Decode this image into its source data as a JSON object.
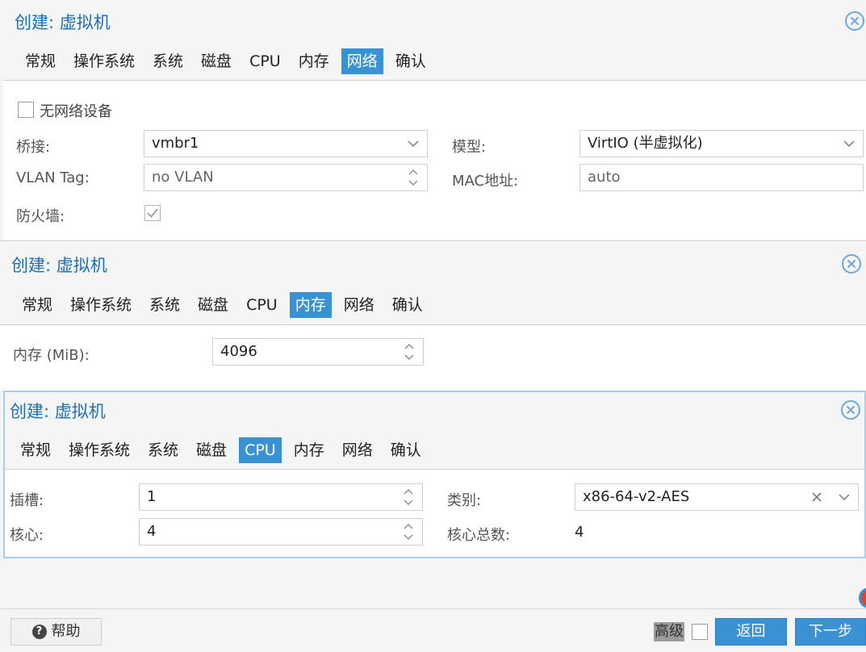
{
  "network": {
    "title": "创建: 虚拟机",
    "tabs": [
      "常规",
      "操作系统",
      "系统",
      "磁盘",
      "CPU",
      "内存",
      "网络",
      "确认"
    ],
    "active_tab": 6,
    "no_network_label": "无网络设备",
    "bridge_label": "桥接:",
    "bridge_value": "vmbr1",
    "model_label": "模型:",
    "model_value": "VirtIO (半虚拟化)",
    "vlan_label": "VLAN Tag:",
    "vlan_value": "no VLAN",
    "mac_label": "MAC地址:",
    "mac_value": "auto",
    "firewall_label": "防火墙:"
  },
  "memory": {
    "title": "创建: 虚拟机",
    "tabs": [
      "常规",
      "操作系统",
      "系统",
      "磁盘",
      "CPU",
      "内存",
      "网络",
      "确认"
    ],
    "active_tab": 5,
    "memory_label": "内存 (MiB):",
    "memory_value": "4096"
  },
  "cpu": {
    "title": "创建: 虚拟机",
    "tabs": [
      "常规",
      "操作系统",
      "系统",
      "磁盘",
      "CPU",
      "内存",
      "网络",
      "确认"
    ],
    "active_tab": 4,
    "sockets_label": "插槽:",
    "sockets_value": "1",
    "cores_label": "核心:",
    "cores_value": "4",
    "type_label": "类别:",
    "type_value": "x86-64-v2-AES",
    "total_cores_label": "核心总数:",
    "total_cores_value": "4"
  },
  "footer": {
    "help_label": "帮助",
    "advanced_label": "高级",
    "back_label": "返回",
    "next_label": "下一步"
  },
  "colors": {
    "accent": "#3892d4",
    "title": "#1e6fb0"
  }
}
